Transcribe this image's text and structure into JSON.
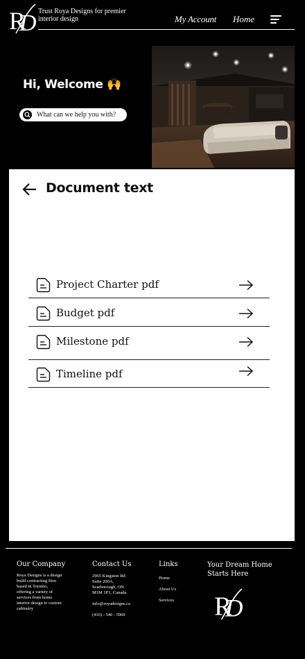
{
  "header": {
    "logo_text": "RD",
    "tagline": "Trust Roya Designs for premier interior design",
    "nav": {
      "account": "My Account",
      "home": "Home"
    }
  },
  "hero": {
    "welcome": "Hi, Welcome 🙌",
    "search_placeholder": "What can we help you with?"
  },
  "main": {
    "title": "Document text",
    "documents": [
      {
        "label": "Project Charter pdf"
      },
      {
        "label": "Budget pdf"
      },
      {
        "label": "Milestone pdf"
      },
      {
        "label": "Timeline pdf"
      }
    ]
  },
  "footer": {
    "company": {
      "heading": "Our Company",
      "text": "Roya Designs is a design build contracting firm based in Toronto, offering a variety of services from home interior design to custom cabinetry"
    },
    "contact": {
      "heading": "Contact Us",
      "address_lines": [
        "2965 Kingston Rd",
        "Suite 200A,",
        "Scarborough, ON",
        "M1M 1P1, Canada"
      ],
      "email": "info@royadesigns.ca",
      "phone": "(416) - 540 - 5969"
    },
    "links": {
      "heading": "Links",
      "items": [
        "Home",
        "About Us",
        "Services"
      ]
    },
    "dream": "Your Dream Home Starts Here"
  }
}
